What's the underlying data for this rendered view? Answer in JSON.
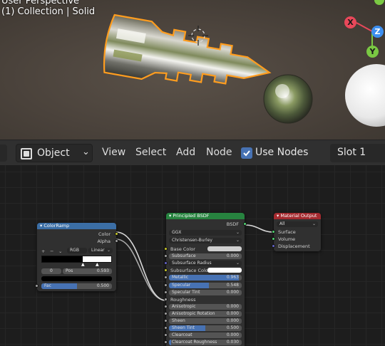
{
  "viewport": {
    "line1": "User Perspective",
    "line2": "(1) Collection | Solid",
    "gizmo": {
      "x_label": "X",
      "y_label": "Y",
      "z_label": "Z",
      "x_color": "#e8485a",
      "y_color": "#7ac943",
      "z_color": "#3d8ff0"
    }
  },
  "header": {
    "object_mode": "Object",
    "menus": [
      "View",
      "Select",
      "Add",
      "Node"
    ],
    "use_nodes_label": "Use Nodes",
    "use_nodes_checked": true,
    "slot_label": "Slot 1"
  },
  "colorramp": {
    "title": "ColorRamp",
    "out_color": "Color",
    "out_alpha": "Alpha",
    "color_mode": "RGB",
    "interpolation": "Linear",
    "stop_index": "0",
    "pos_label": "Pos",
    "pos_value": "0.593",
    "fac_label": "Fac",
    "fac_value": "0.500",
    "header_color": "#3b6ea5"
  },
  "bsdf": {
    "title": "Principled BSDF",
    "out": "BSDF",
    "distribution": "GGX",
    "subsurface_method": "Christensen-Burley",
    "header_color": "#27833f",
    "rows": [
      {
        "label": "Base Color",
        "type": "color"
      },
      {
        "label": "Subsurface",
        "value": "0.000",
        "fill": 0.0
      },
      {
        "label": "Subsurface Radius",
        "type": "dropdown"
      },
      {
        "label": "Subsurface Color",
        "type": "color"
      },
      {
        "label": "Metallic",
        "value": "0.963",
        "fill": 0.963
      },
      {
        "label": "Specular",
        "value": "0.548",
        "fill": 0.548
      },
      {
        "label": "Specular Tint",
        "value": "0.000",
        "fill": 0.0
      },
      {
        "label": "Roughness",
        "type": "linked"
      },
      {
        "label": "Anisotropic",
        "value": "0.000",
        "fill": 0.0
      },
      {
        "label": "Anisotropic Rotation",
        "value": "0.000",
        "fill": 0.0
      },
      {
        "label": "Sheen",
        "value": "0.000",
        "fill": 0.0
      },
      {
        "label": "Sheen Tint",
        "value": "0.500",
        "fill": 0.5
      },
      {
        "label": "Clearcoat",
        "value": "0.000",
        "fill": 0.0
      },
      {
        "label": "Clearcoat Roughness",
        "value": "0.030",
        "fill": 0.03
      }
    ]
  },
  "material_output": {
    "title": "Material Output",
    "target": "All",
    "inputs": [
      "Surface",
      "Volume",
      "Displacement"
    ],
    "header_color": "#a42a2f"
  }
}
